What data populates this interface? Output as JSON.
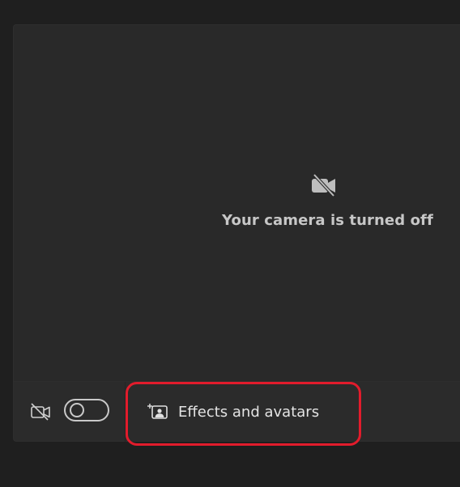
{
  "preview": {
    "camera_off_icon": "video-off-icon",
    "camera_off_text": "Your camera is turned off"
  },
  "controls": {
    "video_icon": "video-off-icon",
    "video_toggle": {
      "state": "off"
    },
    "effects_button": {
      "icon": "effects-avatar-icon",
      "label": "Effects and avatars"
    }
  },
  "annotation": {
    "highlight_color": "#e21c2c"
  },
  "colors": {
    "background": "#1f1f1f",
    "panel": "#292929",
    "text": "#c7c7c7"
  }
}
